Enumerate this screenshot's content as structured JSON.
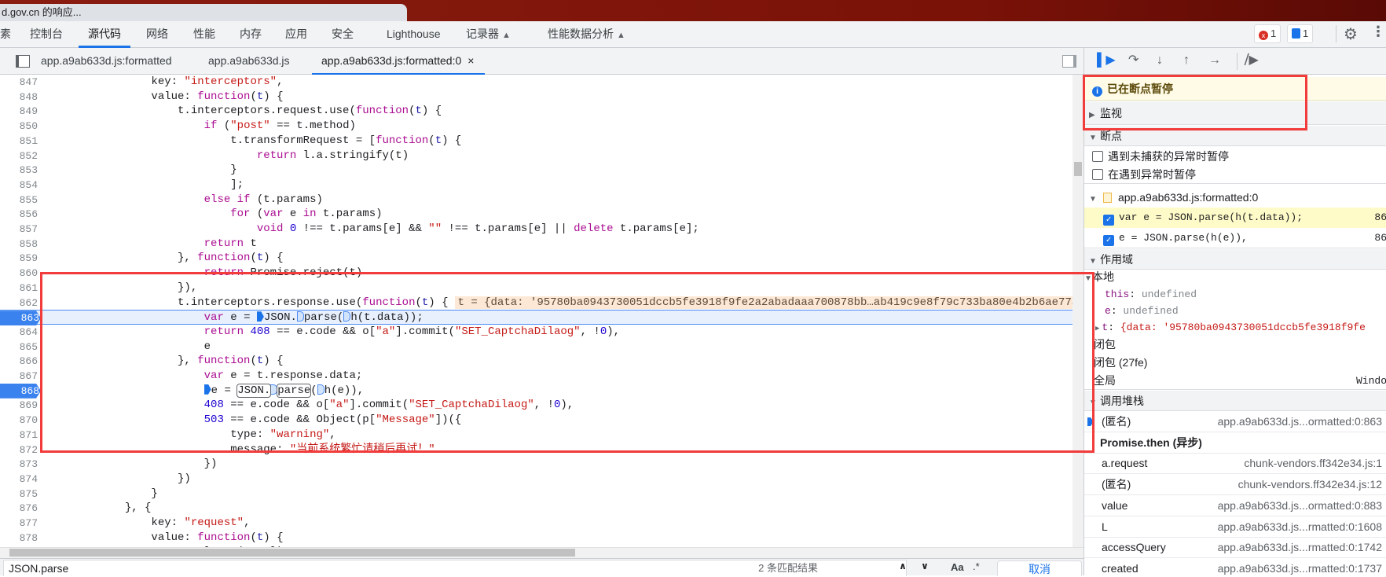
{
  "browser_tab": {
    "title": "d.gov.cn 的响应..."
  },
  "main_tabs": [
    {
      "label": "素"
    },
    {
      "label": "控制台"
    },
    {
      "label": "源代码",
      "active": true
    },
    {
      "label": "网络"
    },
    {
      "label": "性能"
    },
    {
      "label": "内存"
    },
    {
      "label": "应用"
    },
    {
      "label": "安全"
    },
    {
      "label": "Lighthouse"
    },
    {
      "label": "记录器",
      "experimental": true
    },
    {
      "label": "性能数据分析",
      "experimental": true
    }
  ],
  "toolbar_right": {
    "errors": "1",
    "messages": "1",
    "error_icon_glyph": "x"
  },
  "file_tabs": [
    {
      "label": "app.a9ab633d.js:formatted"
    },
    {
      "label": "app.a9ab633d.js"
    },
    {
      "label": "app.a9ab633d.js:formatted:0",
      "active": true,
      "close": "×"
    }
  ],
  "code": {
    "current_line": 863,
    "breakpoint_lines": [
      863,
      868
    ],
    "lines": [
      {
        "n": "847",
        "t": [
          [
            "                key: ",
            "p"
          ],
          [
            "\"interceptors\"",
            "s"
          ],
          [
            ",",
            "p"
          ]
        ]
      },
      {
        "n": "848",
        "t": [
          [
            "                value: ",
            "p"
          ],
          [
            "function",
            "k"
          ],
          [
            "(",
            "p"
          ],
          [
            "t",
            "v"
          ],
          [
            ") {",
            "p"
          ]
        ]
      },
      {
        "n": "849",
        "t": [
          [
            "                    t.interceptors.request.use(",
            "p"
          ],
          [
            "function",
            "k"
          ],
          [
            "(",
            "p"
          ],
          [
            "t",
            "v"
          ],
          [
            ") {",
            "p"
          ]
        ]
      },
      {
        "n": "850",
        "t": [
          [
            "                        ",
            "p"
          ],
          [
            "if",
            "k"
          ],
          [
            " (",
            "p"
          ],
          [
            "\"post\"",
            "s"
          ],
          [
            " == t.method)",
            "p"
          ]
        ]
      },
      {
        "n": "851",
        "t": [
          [
            "                            t.transformRequest = [",
            "p"
          ],
          [
            "function",
            "k"
          ],
          [
            "(",
            "p"
          ],
          [
            "t",
            "v"
          ],
          [
            ") {",
            "p"
          ]
        ]
      },
      {
        "n": "852",
        "t": [
          [
            "                                ",
            "p"
          ],
          [
            "return",
            "k"
          ],
          [
            " l.a.stringify(t)",
            "p"
          ]
        ]
      },
      {
        "n": "853",
        "t": [
          [
            "                            }",
            "p"
          ]
        ]
      },
      {
        "n": "854",
        "t": [
          [
            "                            ];",
            "p"
          ]
        ]
      },
      {
        "n": "855",
        "t": [
          [
            "                        ",
            "p"
          ],
          [
            "else if",
            "k"
          ],
          [
            " (t.params)",
            "p"
          ]
        ]
      },
      {
        "n": "856",
        "t": [
          [
            "                            ",
            "p"
          ],
          [
            "for",
            "k"
          ],
          [
            " (",
            "p"
          ],
          [
            "var",
            "k"
          ],
          [
            " e ",
            "p"
          ],
          [
            "in",
            "k"
          ],
          [
            " t.params)",
            "p"
          ]
        ]
      },
      {
        "n": "857",
        "t": [
          [
            "                                ",
            "p"
          ],
          [
            "void",
            "k"
          ],
          [
            " ",
            "p"
          ],
          [
            "0",
            "n"
          ],
          [
            " !== t.params[e] && ",
            "p"
          ],
          [
            "\"\"",
            "s"
          ],
          [
            " !== t.params[e] || ",
            "p"
          ],
          [
            "delete",
            "k"
          ],
          [
            " t.params[e];",
            "p"
          ]
        ]
      },
      {
        "n": "858",
        "t": [
          [
            "                        ",
            "p"
          ],
          [
            "return",
            "k"
          ],
          [
            " t",
            "p"
          ]
        ]
      },
      {
        "n": "859",
        "t": [
          [
            "                    }, ",
            "p"
          ],
          [
            "function",
            "k"
          ],
          [
            "(",
            "p"
          ],
          [
            "t",
            "v"
          ],
          [
            ") {",
            "p"
          ]
        ]
      },
      {
        "n": "860",
        "t": [
          [
            "                        ",
            "p"
          ],
          [
            "return",
            "k"
          ],
          [
            " Promise.reject(t)",
            "p"
          ]
        ]
      },
      {
        "n": "861",
        "t": [
          [
            "                    }),",
            "p"
          ]
        ]
      },
      {
        "n": "862",
        "t": [
          [
            "                    t.interceptors.response.use(",
            "p"
          ],
          [
            "function",
            "k"
          ],
          [
            "(",
            "p"
          ],
          [
            "t",
            "v"
          ],
          [
            ") {",
            "p"
          ]
        ],
        "inline": "t = {data: '95780ba0943730051dccb5fe3918f9fe2a2abadaaa700878bb…ab419c9e8f79c733ba80e4b2b6ae77a"
      },
      {
        "n": "863",
        "t": [
          [
            "                        ",
            "p"
          ],
          [
            "var",
            "k"
          ],
          [
            " e = ",
            "p"
          ],
          [
            "",
            "bpf"
          ],
          [
            "JSON.",
            "p"
          ],
          [
            "",
            "bpo"
          ],
          [
            "parse(",
            "p"
          ],
          [
            "",
            "bpo"
          ],
          [
            "h(t.data));",
            "p"
          ]
        ]
      },
      {
        "n": "864",
        "t": [
          [
            "                        ",
            "p"
          ],
          [
            "return",
            "k"
          ],
          [
            " ",
            "p"
          ],
          [
            "408",
            "n"
          ],
          [
            " == e.code && o[",
            "p"
          ],
          [
            "\"a\"",
            "s"
          ],
          [
            "].commit(",
            "p"
          ],
          [
            "\"SET_CaptchaDilaog\"",
            "s"
          ],
          [
            ", !",
            "p"
          ],
          [
            "0",
            "n"
          ],
          [
            "),",
            "p"
          ]
        ]
      },
      {
        "n": "865",
        "t": [
          [
            "                        e",
            "p"
          ]
        ]
      },
      {
        "n": "866",
        "t": [
          [
            "                    }, ",
            "p"
          ],
          [
            "function",
            "k"
          ],
          [
            "(",
            "p"
          ],
          [
            "t",
            "v"
          ],
          [
            ") {",
            "p"
          ]
        ]
      },
      {
        "n": "867",
        "t": [
          [
            "                        ",
            "p"
          ],
          [
            "var",
            "k"
          ],
          [
            " e = t.response.data;",
            "p"
          ]
        ]
      },
      {
        "n": "868",
        "t": [
          [
            "                        ",
            "p"
          ],
          [
            "",
            "bpf"
          ],
          [
            "e = ",
            "p"
          ],
          [
            "JSON.",
            "hl"
          ],
          [
            "",
            "bpo"
          ],
          [
            "parse",
            "hl"
          ],
          [
            "(",
            "p"
          ],
          [
            "",
            "bpo"
          ],
          [
            "h(e)),",
            "p"
          ]
        ]
      },
      {
        "n": "869",
        "t": [
          [
            "                        ",
            "p"
          ],
          [
            "408",
            "n"
          ],
          [
            " == e.code && o[",
            "p"
          ],
          [
            "\"a\"",
            "s"
          ],
          [
            "].commit(",
            "p"
          ],
          [
            "\"SET_CaptchaDilaog\"",
            "s"
          ],
          [
            ", !",
            "p"
          ],
          [
            "0",
            "n"
          ],
          [
            "),",
            "p"
          ]
        ]
      },
      {
        "n": "870",
        "t": [
          [
            "                        ",
            "p"
          ],
          [
            "503",
            "n"
          ],
          [
            " == e.code && Object(p[",
            "p"
          ],
          [
            "\"Message\"",
            "s"
          ],
          [
            "])({",
            "p"
          ]
        ]
      },
      {
        "n": "871",
        "t": [
          [
            "                            type: ",
            "p"
          ],
          [
            "\"warning\"",
            "s"
          ],
          [
            ",",
            "p"
          ]
        ]
      },
      {
        "n": "872",
        "t": [
          [
            "                            message: ",
            "p"
          ],
          [
            "\"当前系统繁忙请稍后再试！\"",
            "s"
          ]
        ]
      },
      {
        "n": "873",
        "t": [
          [
            "                        })",
            "p"
          ]
        ]
      },
      {
        "n": "874",
        "t": [
          [
            "                    })",
            "p"
          ]
        ]
      },
      {
        "n": "875",
        "t": [
          [
            "                }",
            "p"
          ]
        ]
      },
      {
        "n": "876",
        "t": [
          [
            "            }, {",
            "p"
          ]
        ]
      },
      {
        "n": "877",
        "t": [
          [
            "                key: ",
            "p"
          ],
          [
            "\"request\"",
            "s"
          ],
          [
            ",",
            "p"
          ]
        ]
      },
      {
        "n": "878",
        "t": [
          [
            "                value: ",
            "p"
          ],
          [
            "function",
            "k"
          ],
          [
            "(",
            "p"
          ],
          [
            "t",
            "v"
          ],
          [
            ") {",
            "p"
          ]
        ]
      },
      {
        "n": "879",
        "t": [
          [
            "                    t.url = g(t.url);",
            "p"
          ]
        ]
      }
    ]
  },
  "search": {
    "query": "JSON.parse",
    "result_count": "2 条匹配结果",
    "match_case": "Aa",
    "regex": ".*",
    "cancel": "取消"
  },
  "debugger": {
    "paused_message": "已在断点暂停",
    "watch_label": "监视",
    "breakpoints_label": "断点",
    "pause_uncaught": {
      "label": "遇到未捕获的异常时暂停",
      "checked": false
    },
    "pause_caught": {
      "label": "在遇到异常时暂停",
      "checked": false
    },
    "bp_file": "app.a9ab633d.js:formatted:0",
    "breakpoints": [
      {
        "code": "var e = JSON.parse(h(t.data));",
        "line": "86",
        "checked": true,
        "active": true
      },
      {
        "code": "e = JSON.parse(h(e)),",
        "line": "86",
        "checked": true
      }
    ],
    "scope_label": "作用域",
    "local_label": "本地",
    "scope_vars": [
      {
        "name": "this",
        "value": "undefined"
      },
      {
        "name": "e",
        "value": "undefined"
      },
      {
        "name": "t",
        "value": "{data: '95780ba0943730051dccb5fe3918f9fe"
      }
    ],
    "closure_label": "闭包",
    "closure2_label": "闭包 (27fe)",
    "global_label": "全局",
    "global_value": "Windo",
    "callstack_label": "调用堆栈",
    "frames": [
      {
        "name": "(匿名)",
        "loc": "app.a9ab633d.js...ormatted:0:863",
        "current": true
      },
      {
        "async": "Promise.then (异步)"
      },
      {
        "name": "a.request",
        "loc": "chunk-vendors.ff342e34.js:1"
      },
      {
        "name": "(匿名)",
        "loc": "chunk-vendors.ff342e34.js:12"
      },
      {
        "name": "value",
        "loc": "app.a9ab633d.js...ormatted:0:883"
      },
      {
        "name": "L",
        "loc": "app.a9ab633d.js...rmatted:0:1608"
      },
      {
        "name": "accessQuery",
        "loc": "app.a9ab633d.js...rmatted:0:1742"
      },
      {
        "name": "created",
        "loc": "app.a9ab633d.js...rmatted:0:1737"
      }
    ]
  },
  "colors": {
    "accent": "#1a73e8",
    "annotation_box": "#f23b3b",
    "paused_bg": "#fffbe6",
    "current_line_bg": "#e8f0fe"
  }
}
